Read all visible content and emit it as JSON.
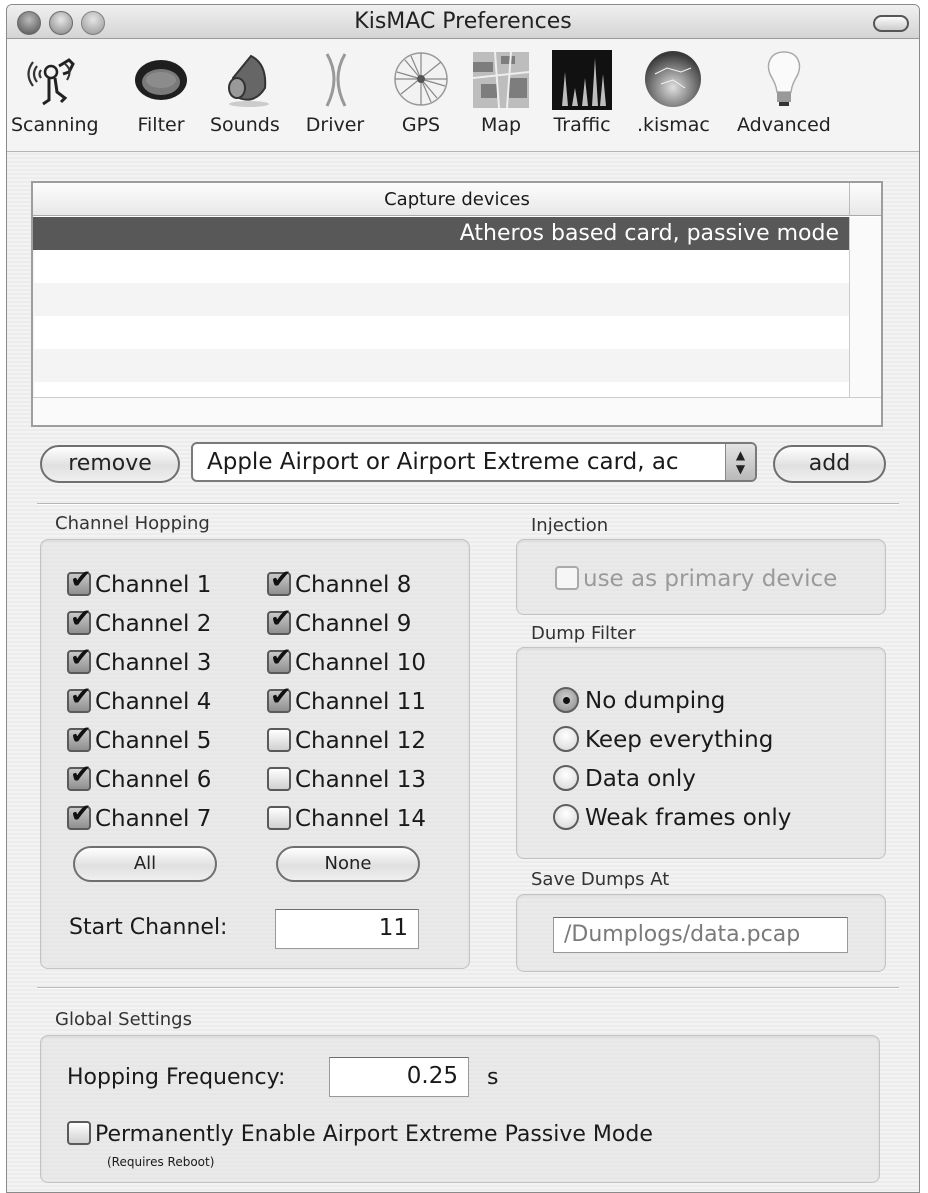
{
  "window": {
    "title": "KisMAC Preferences"
  },
  "toolbar": {
    "items": [
      {
        "label": "Scanning",
        "icon": "scanning-icon"
      },
      {
        "label": "Filter",
        "icon": "filter-icon"
      },
      {
        "label": "Sounds",
        "icon": "speaker-icon"
      },
      {
        "label": "Driver",
        "icon": "driver-icon"
      },
      {
        "label": "GPS",
        "icon": "globe-wire-icon"
      },
      {
        "label": "Map",
        "icon": "map-icon"
      },
      {
        "label": "Traffic",
        "icon": "traffic-graph-icon"
      },
      {
        "label": ".kismac",
        "icon": "sphere-icon"
      },
      {
        "label": "Advanced",
        "icon": "lightbulb-icon"
      }
    ]
  },
  "capture": {
    "column_header": "Capture devices",
    "rows": [
      "Atheros based card, passive mode",
      "",
      "",
      "",
      ""
    ],
    "selected_index": 0,
    "remove_label": "remove",
    "add_label": "add",
    "device_select_value": "Apple Airport or Airport Extreme card, active mode",
    "device_select_visible": "Apple Airport or Airport Extreme card, ac"
  },
  "channel_hopping": {
    "title": "Channel Hopping",
    "channels": [
      {
        "label": "Channel 1",
        "checked": true
      },
      {
        "label": "Channel 2",
        "checked": true
      },
      {
        "label": "Channel 3",
        "checked": true
      },
      {
        "label": "Channel 4",
        "checked": true
      },
      {
        "label": "Channel 5",
        "checked": true
      },
      {
        "label": "Channel 6",
        "checked": true
      },
      {
        "label": "Channel 7",
        "checked": true
      },
      {
        "label": "Channel 8",
        "checked": true
      },
      {
        "label": "Channel 9",
        "checked": true
      },
      {
        "label": "Channel 10",
        "checked": true
      },
      {
        "label": "Channel 11",
        "checked": true
      },
      {
        "label": "Channel 12",
        "checked": false
      },
      {
        "label": "Channel 13",
        "checked": false
      },
      {
        "label": "Channel 14",
        "checked": false
      }
    ],
    "all_label": "All",
    "none_label": "None",
    "start_channel_label": "Start Channel:",
    "start_channel_value": "11"
  },
  "injection": {
    "title": "Injection",
    "primary_label": "use as primary device",
    "primary_checked": false,
    "primary_enabled": false
  },
  "dump_filter": {
    "title": "Dump Filter",
    "options": [
      {
        "label": "No dumping",
        "selected": true
      },
      {
        "label": "Keep everything",
        "selected": false
      },
      {
        "label": "Data only",
        "selected": false
      },
      {
        "label": "Weak frames only",
        "selected": false
      }
    ]
  },
  "save_dumps": {
    "title": "Save Dumps At",
    "path": "/Dumplogs/data.pcap"
  },
  "global": {
    "title": "Global Settings",
    "hopping_label": "Hopping Frequency:",
    "hopping_value": "0.25",
    "hopping_unit": "s",
    "passive_label": "Permanently Enable Airport Extreme Passive Mode",
    "passive_checked": false,
    "passive_note": "(Requires Reboot)"
  },
  "colors": {
    "selection": "#585858",
    "window_bg": "#ececec"
  }
}
